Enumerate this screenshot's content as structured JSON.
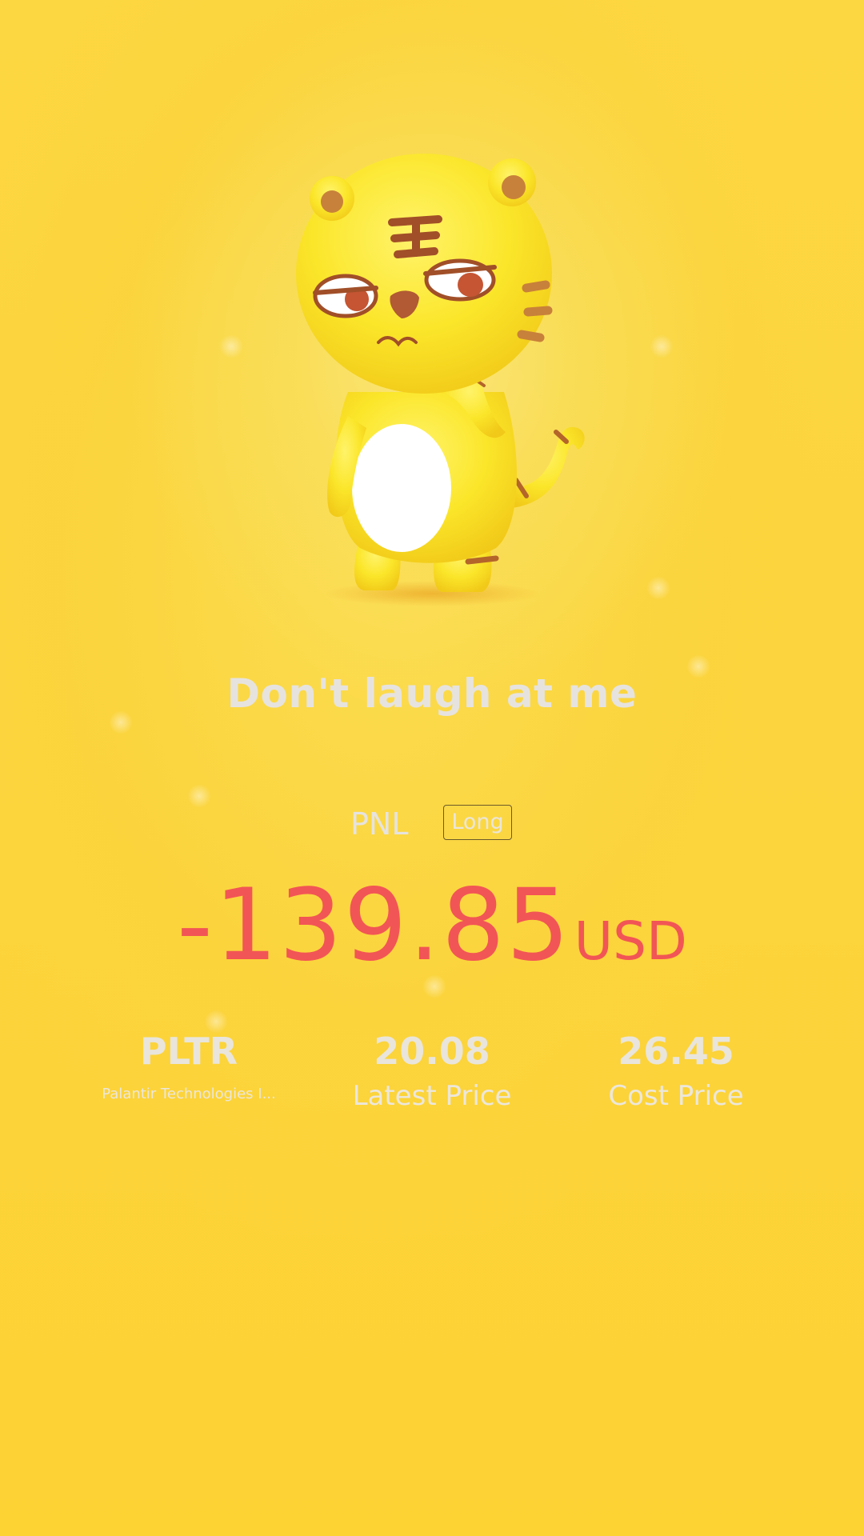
{
  "card": {
    "caption": "Don't laugh at me",
    "pnl_label": "PNL",
    "position_badge": "Long",
    "pnl_value": "-139.85",
    "pnl_unit": "USD",
    "pnl_color": "#f25555"
  },
  "stats": [
    {
      "value": "PLTR",
      "label": "Palantir Technologies I..."
    },
    {
      "value": "20.08",
      "label": "Latest Price"
    },
    {
      "value": "26.45",
      "label": "Cost Price"
    }
  ],
  "mascot": {
    "icon": "tiger-mascot-icon",
    "face_text": "王"
  }
}
